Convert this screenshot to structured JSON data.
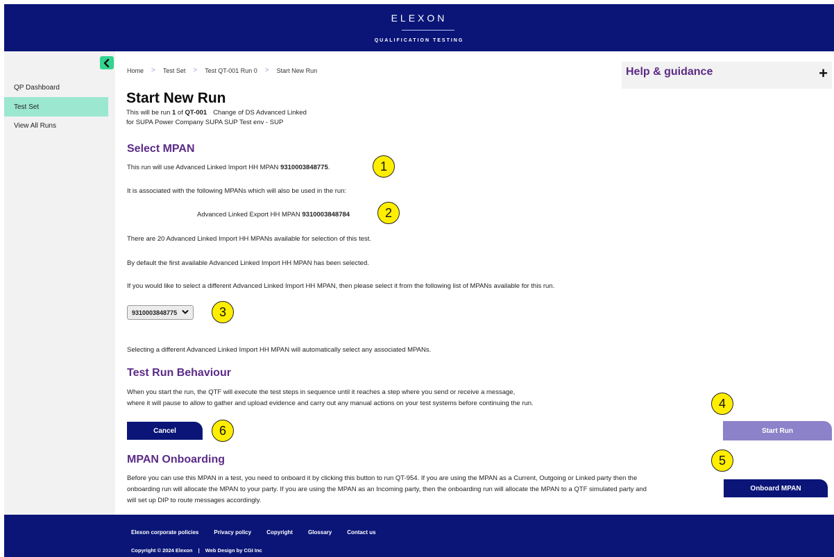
{
  "header": {
    "brand": "ELEXON",
    "subtitle": "QUALIFICATION TESTING"
  },
  "sidebar": {
    "items": [
      {
        "label": "QP Dashboard"
      },
      {
        "label": "Test Set"
      },
      {
        "label": "View All Runs"
      }
    ]
  },
  "breadcrumb": [
    "Home",
    "Test Set",
    "Test QT-001 Run 0",
    "Start New Run"
  ],
  "help": {
    "title": "Help & guidance",
    "toggle": "+"
  },
  "main": {
    "title": "Start New Run",
    "run_line": {
      "prefix": "This will be run ",
      "run_no": "1",
      "mid": " of ",
      "test_id": "QT-001",
      "test_name": "Change of DS Advanced Linked"
    },
    "party_line": "for SUPA Power Company SUPA SUP Test env - SUP",
    "select_mpan": {
      "heading": "Select MPAN",
      "use_text": "This run will use Advanced Linked Import HH MPAN ",
      "use_mpan": "9310003848775",
      "assoc_text": "It is associated with the following MPANs which will also be used in the run:",
      "export_text": "Advanced Linked Export HH MPAN ",
      "export_mpan": "9310003848784",
      "available_text": "There are 20 Advanced Linked Import HH MPANs available for selection of this test.",
      "default_text": "By default the first available Advanced Linked Import HH MPAN has been selected.",
      "instruction_text": "If you would like to select a different Advanced Linked Import HH MPAN, then please select it from the following list of MPANs available for this run.",
      "dropdown_value": "9310003848775",
      "auto_text": "Selecting a different Advanced Linked Import HH MPAN will automatically select any associated MPANs."
    },
    "behaviour": {
      "heading": "Test Run Behaviour",
      "line1": "When you start the run, the QTF will execute the test steps in sequence until it reaches a step where you send or receive a message,",
      "line2": "where it will pause to allow to gather and upload evidence and carry out any manual actions on your test systems before continuing the run."
    },
    "cancel_label": "Cancel",
    "start_run_label": "Start Run",
    "onboarding": {
      "heading": "MPAN Onboarding",
      "line1": "Before you can use this MPAN in a test, you need to onboard it by clicking this button to run QT-954. If you are using the MPAN as a Current, Outgoing or Linked party then the",
      "line2": "onboarding run will allocate the MPAN to your party. If you are using the MPAN as an Incoming party, then the onboarding run will allocate the MPAN to a QTF simulated party and",
      "line3": "will set up DIP to route messages accordingly.",
      "button_label": "Onboard MPAN"
    },
    "callouts": [
      "1",
      "2",
      "3",
      "4",
      "5",
      "6"
    ]
  },
  "footer": {
    "links": [
      "Elexon corporate policies",
      "Privacy policy",
      "Copyright",
      "Glossary",
      "Contact us"
    ],
    "copyright": "Copyright © 2024 Elexon",
    "credit": "Web Design by CGI Inc"
  },
  "colors": {
    "navy": "#0a1577",
    "purple_heading": "#5b2b86",
    "active_nav": "#9be7d0",
    "start_run_btn": "#8b82c9",
    "callout": "#ffee00"
  }
}
